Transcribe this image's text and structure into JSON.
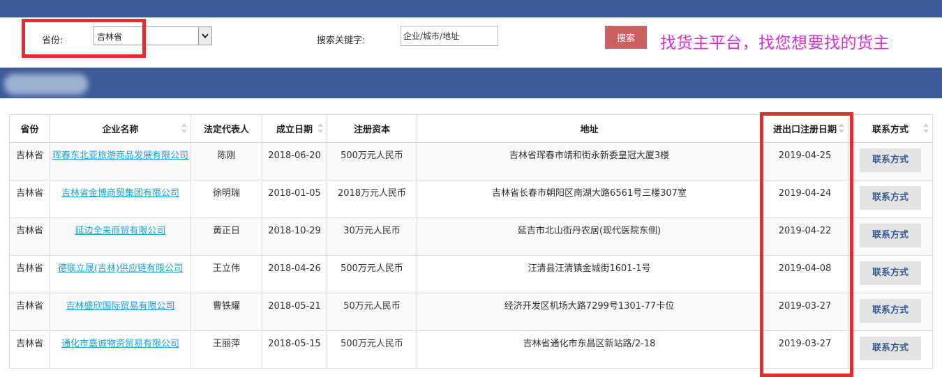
{
  "filters": {
    "province_label": "省份:",
    "province_value": "吉林省",
    "keyword_label": "搜索关键字:",
    "keyword_value": "企业/城市/地址",
    "search_button": "搜索"
  },
  "slogan": "找货主平台，找您想要找的货主",
  "table": {
    "headers": [
      "省份",
      "企业名称",
      "法定代表人",
      "成立日期",
      "注册资本",
      "地址",
      "进出口注册日期",
      "联系方式"
    ],
    "rows": [
      {
        "province": "吉林省",
        "company": "珲春东北亚旅游商品发展有限公司",
        "legal_rep": "陈刚",
        "founded": "2018-06-20",
        "capital": "500万元人民币",
        "address": "吉林省珲春市靖和街永新委皇冠大厦3楼",
        "ie_date": "2019-04-25",
        "contact": "联系方式"
      },
      {
        "province": "吉林省",
        "company": "吉林省金博商贸集团有限公司",
        "legal_rep": "徐明瑞",
        "founded": "2018-01-05",
        "capital": "2018万元人民币",
        "address": "吉林省长春市朝阳区南湖大路6561号三楼307室",
        "ie_date": "2019-04-24",
        "contact": "联系方式"
      },
      {
        "province": "吉林省",
        "company": "延边全来商贸有限公司",
        "legal_rep": "黄正日",
        "founded": "2018-10-29",
        "capital": "30万元人民币",
        "address": "延吉市北山街丹农居(现代医院东侧)",
        "ie_date": "2019-04-22",
        "contact": "联系方式"
      },
      {
        "province": "吉林省",
        "company": "德联立晟(吉林)供应链有限公司",
        "legal_rep": "王立伟",
        "founded": "2018-04-26",
        "capital": "500万元人民币",
        "address": "汪清县汪清镇金城街1601-1号",
        "ie_date": "2019-04-08",
        "contact": "联系方式"
      },
      {
        "province": "吉林省",
        "company": "吉林盛欣国际贸易有限公司",
        "legal_rep": "曹铁耀",
        "founded": "2018-05-21",
        "capital": "50万元人民币",
        "address": "经济开发区机场大路7299号1301-77卡位",
        "ie_date": "2019-03-27",
        "contact": "联系方式"
      },
      {
        "province": "吉林省",
        "company": "通化市嘉诚物资贸易有限公司",
        "legal_rep": "王丽萍",
        "founded": "2018-05-15",
        "capital": "500万元人民币",
        "address": "吉林省通化市东昌区新站路/2-18",
        "ie_date": "2019-03-27",
        "contact": "联系方式"
      }
    ]
  },
  "colors": {
    "header_bar": "#3c5b9a",
    "search_button": "#c9625f",
    "slogan": "#d630d6",
    "link": "#1aa2d6",
    "highlight_box": "#e52d2d",
    "contact_button_text": "#3a5b92"
  }
}
